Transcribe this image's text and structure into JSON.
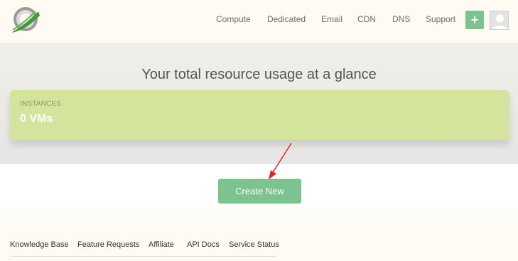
{
  "header": {
    "logo_icon": "vultr-style-logo-icon",
    "nav": [
      {
        "label": "Compute"
      },
      {
        "label": "Dedicated"
      },
      {
        "label": "Email"
      },
      {
        "label": "CDN"
      },
      {
        "label": "DNS"
      },
      {
        "label": "Support"
      }
    ],
    "add_icon": "plus-icon",
    "add_glyph": "+",
    "avatar_icon": "user-avatar-icon"
  },
  "hero": {
    "title": "Your total resource usage at a glance",
    "card": {
      "label": "INSTANCES",
      "value": "0 VMs",
      "color": "#d5e49c"
    }
  },
  "main": {
    "create_button_label": "Create New",
    "accent_color": "#7cc48f",
    "annotation": "red-arrow-pointing-to-create-button"
  },
  "footer": {
    "links": [
      {
        "label": "Knowledge Base"
      },
      {
        "label": "Feature Requests"
      },
      {
        "label": "Affiliate"
      },
      {
        "label": "API Docs"
      },
      {
        "label": "Service Status"
      }
    ]
  }
}
